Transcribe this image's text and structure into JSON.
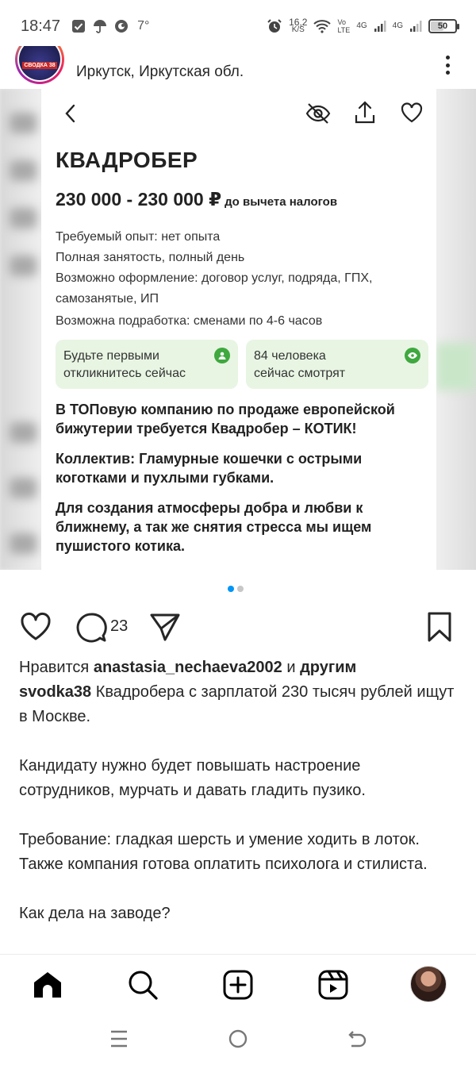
{
  "status_bar": {
    "time": "18:47",
    "temperature": "7°",
    "net_speed_value": "16,2",
    "net_speed_unit": "K/S",
    "volte_top": "Vo",
    "volte_bottom": "LTE",
    "signal_1": "4G",
    "signal_2": "4G",
    "battery": "50"
  },
  "post_header": {
    "avatar_tag": "СВОДКА 38",
    "location": "Иркутск, Иркутская обл."
  },
  "card": {
    "title": "КВАДРОБЕР",
    "salary": "230 000 - 230 000 ₽",
    "salary_note": "до вычета налогов",
    "details": [
      "Требуемый опыт: нет опыта",
      "Полная занятость, полный день",
      "Возможно оформление: договор услуг, подряда, ГПХ, самозанятые, ИП",
      "Возможна подработка: сменами по 4-6 часов"
    ],
    "chip1_line1": "Будьте первыми",
    "chip1_line2": "откликнитесь сейчас",
    "chip2_line1": "84 человека",
    "chip2_line2": "сейчас смотрят",
    "paragraphs": [
      "В ТОПовую компанию по продаже европейской бижутерии требуется Квадробер – КОТИК!",
      "Коллектив: Гламурные кошечки с острыми коготками и пухлыми губками.",
      "Для создания атмосферы добра и любви к ближнему, а так же снятия стресса мы ищем пушистого котика."
    ]
  },
  "carousel": {
    "total": 2,
    "active": 1
  },
  "actions": {
    "comment_count": "23"
  },
  "caption": {
    "likes_prefix": "Нравится",
    "likes_user": "anastasia_nechaeva2002",
    "likes_and": "и",
    "likes_others": "другим",
    "author": "svodka38",
    "text_1": "Квадробера с зарплатой 230 тысяч рублей ищут в Москве.",
    "text_2": "Кандидату нужно будет повышать настроение сотрудников, мурчать и давать гладить пузико.",
    "text_3": "Требование: гладкая шерсть и умение ходить в лоток. Также компания готова оплатить психолога и стилиста.",
    "text_4": "Как дела на заводе?"
  },
  "bottom_nav": {
    "icons": [
      "home-icon",
      "search-icon",
      "create-icon",
      "reels-icon",
      "profile-avatar"
    ]
  },
  "system_nav": {
    "icons": [
      "menu-icon",
      "home-circle-icon",
      "back-icon"
    ]
  },
  "colors": {
    "accent_blue": "#0095f6",
    "chip_green_bg": "#e8f5e3",
    "chip_green_icon": "#3fa83f",
    "text": "#262626"
  }
}
